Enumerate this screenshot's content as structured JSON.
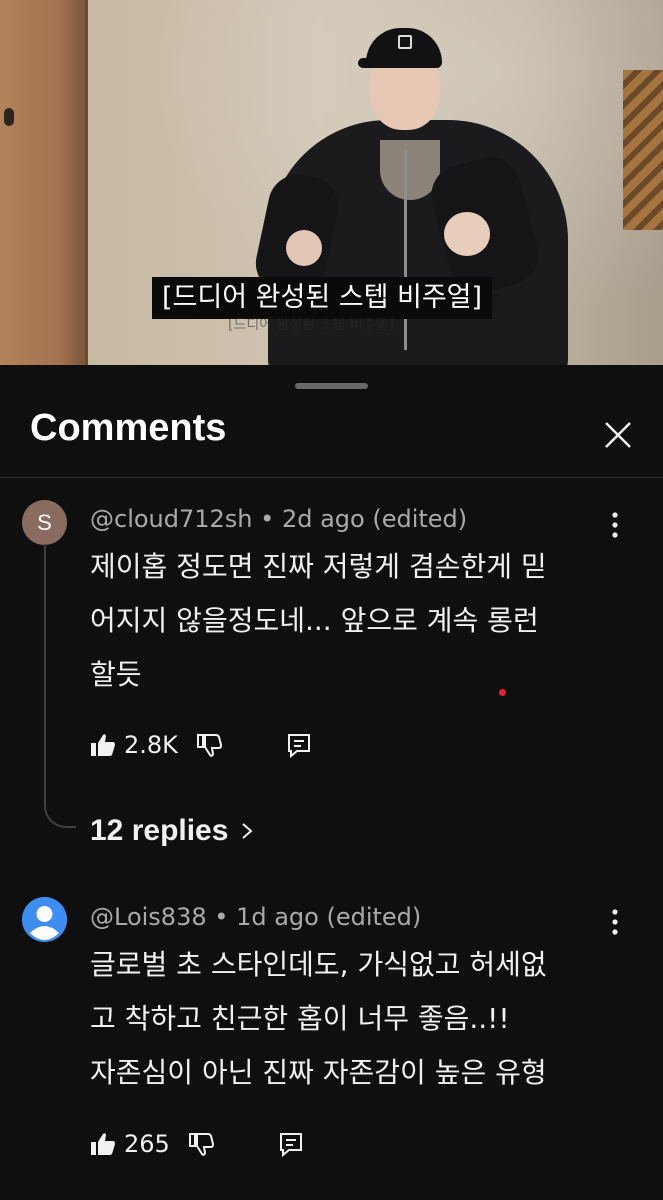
{
  "video": {
    "subtitle": "[드디어 완성된 스텝 비주얼]",
    "subtitle_ghost": "[드디어 완성된 스텝 비주얼]"
  },
  "sheet": {
    "title": "Comments"
  },
  "comments": [
    {
      "avatar_letter": "S",
      "author": "@cloud712sh",
      "time": "2d ago (edited)",
      "lines": [
        "제이홉 정도면 진짜 저렇게 겸손한게 믿",
        "어지지 않을정도네... 앞으로 계속 롱런",
        "할듯"
      ],
      "likes": "2.8K",
      "replies_label": "12 replies"
    },
    {
      "author": "@Lois838",
      "time": "1d ago (edited)",
      "lines": [
        "글로벌 초 스타인데도, 가식없고 허세없",
        "고 착하고 친근한 홉이 너무 좋음..!!",
        "자존심이 아닌 진짜 자존감이 높은 유형"
      ],
      "likes": "265"
    }
  ],
  "colors": {
    "background": "#0f0f0f",
    "text_primary": "#f1f1f1",
    "text_secondary": "#aaaaaa",
    "avatar_s": "#8a6b5f",
    "avatar_user": "#3d8ef0"
  }
}
